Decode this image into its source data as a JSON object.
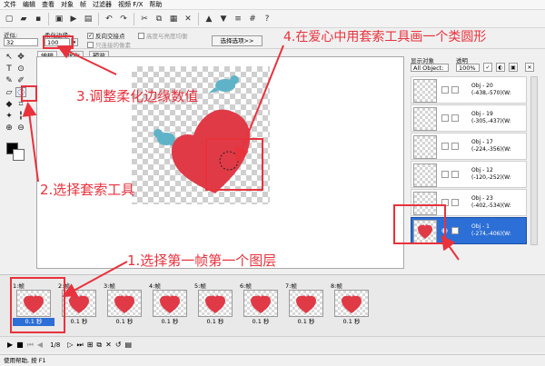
{
  "menu": [
    "文件",
    "编辑",
    "查看",
    "对象",
    "帧",
    "过滤器",
    "视频 F/X",
    "帮助"
  ],
  "options": {
    "approx_label": "近似:",
    "approx_value": "32",
    "feather_label": "柔化边缘:",
    "feather_value": "100",
    "invert_label": "反向交接点",
    "invert_checked": true,
    "antialias_label": "只连接的像素",
    "antialias_checked": false,
    "highlight_label": "高度与亮度均衡",
    "highlight_checked": false,
    "select_button": "选择选项>>"
  },
  "tabs": [
    "编辑",
    "优化",
    "预览"
  ],
  "right_panel": {
    "display_label": "显示对象",
    "display_value": "All Object:",
    "opacity_label": "透明",
    "opacity_value": "100%",
    "objects": [
      {
        "name": "Obj - 20",
        "coords": "(-438,-570)(W:"
      },
      {
        "name": "Obj - 19",
        "coords": "(-305,-437)(W:"
      },
      {
        "name": "Obj - 17",
        "coords": "(-224,-356)(W:"
      },
      {
        "name": "Obj - 12",
        "coords": "(-120,-252)(W:"
      },
      {
        "name": "Obj - 23",
        "coords": "(-402,-534)(W:"
      },
      {
        "name": "Obj - 1",
        "coords": "(-274,-406)(W:",
        "selected": true
      }
    ]
  },
  "frames": [
    {
      "label": "1:帧",
      "delay": "0.1 秒"
    },
    {
      "label": "2:帧",
      "delay": "0.1 秒"
    },
    {
      "label": "3:帧",
      "delay": "0.1 秒"
    },
    {
      "label": "4:帧",
      "delay": "0.1 秒"
    },
    {
      "label": "5:帧",
      "delay": "0.1 秒"
    },
    {
      "label": "6:帧",
      "delay": "0.1 秒"
    },
    {
      "label": "7:帧",
      "delay": "0.1 秒"
    },
    {
      "label": "8:帧",
      "delay": "0.1 秒"
    }
  ],
  "playbar": {
    "frame_counter": "1/8"
  },
  "status": "使用帮助, 按 F1",
  "annotations": {
    "step1": "1.选择第一帧第一个图层",
    "step2": "2.选择套索工具",
    "step3": "3.调整柔化边缘数值",
    "step4": "4.在爱心中用套索工具画一个类圆形"
  },
  "colors": {
    "annotation_red": "#e8323c",
    "heart_red": "#e03a47",
    "bird_teal": "#5fb3c8",
    "selection_blue": "#2c6fd6"
  },
  "icons": [
    "pointer-icon",
    "move-icon",
    "text-icon",
    "eyedropper-icon",
    "pencil-icon",
    "brush-icon",
    "lasso-icon",
    "fill-icon",
    "crop-icon",
    "zoom-icon",
    "hand-icon"
  ]
}
